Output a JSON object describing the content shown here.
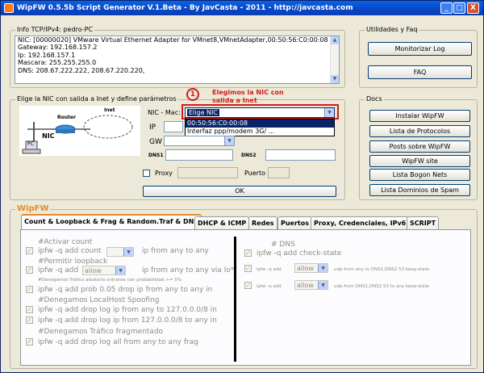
{
  "window": {
    "title": "WipFW 0.5.5b Script Generator V.1.Beta - By JavCasta - 2011 - http://javcasta.com",
    "minimize": "_",
    "maximize": "□",
    "close": "X"
  },
  "info": {
    "caption": "Info TCP/IPv4: pedro-PC",
    "lines": [
      "NIC: [00000020] VMware Virtual Ethernet Adapter for VMnet8,VMnetAdapter,00:50:56:C0:00:08",
      "Gateway: 192.168.157.2",
      "Ip: 192.168.157.1",
      "Mascara: 255.255.255.0",
      "DNS: 208.67.222.222, 208.67.220.220,"
    ]
  },
  "utilidades": {
    "caption": "Utilidades y Faq",
    "monitorizar": "Monitorizar Log",
    "faq": "FAQ"
  },
  "nic": {
    "caption": "Elige la NIC con salida a Inet y define parámetros",
    "diagram": {
      "inet": "Inet",
      "router": "Router",
      "nic": "NIC",
      "pc": "PC"
    },
    "nic_mac_label": "NIC - Mac:",
    "nic_selected": "Elige NIC",
    "nic_options": [
      "00:50:56:C0:00:08",
      "Interfaz ppp/modem 3G/ ..."
    ],
    "ip_label": "IP",
    "gw_label": "GW",
    "dns1_label": "DNS1",
    "dns2_label": "DNS2",
    "proxy_label": "Proxy",
    "puerto_label": "Puerto",
    "ok": "OK",
    "annotation_number": "1",
    "annotation_text": "Elegimos la NIC con salida a Inet"
  },
  "docs": {
    "caption": "Docs",
    "buttons": [
      "Instalar WipFW",
      "Lista de Protocolos",
      "Posts sobre WipFW",
      "WipFW site",
      "Lista Bogon Nets",
      "Lista Dominios de Spam"
    ]
  },
  "wipfw": {
    "caption": "WipFW",
    "tabs": [
      "Count & Loopback & Frag & Random.Traf & DNS",
      "DHCP & ICMP",
      "Redes",
      "Puertos",
      "Proxy, Credenciales, IPv6",
      "SCRIPT"
    ],
    "left": {
      "activar_count": "#Activar count",
      "count_pre": "ipfw -q add  count",
      "count_post": "ip from any to any",
      "permitir_loopback": "#Permitir loopback",
      "loop_pre": "ipfw -q add",
      "loop_value": "allow",
      "loop_post": "ip from any to any via lo*",
      "denegamos_aleatorio": "#Denegamos Tráfico aleatorio entrante con probabilidad >= 5%",
      "prob_rule": "ipfw -q add prob 0.05 drop ip from any to any in",
      "denegamos_localhost": "#Denegamos LocalHost Spoofing",
      "spoof1": "ipfw -q add drop log ip from any to 127.0.0.0/8 in",
      "spoof2": "ipfw -q add drop log ip from 127.0.0.0/8 to any in",
      "denegamos_frag": "#Denegamos Tráfico fragmentado",
      "frag_rule": "ipfw -q add drop log all from any to any frag"
    },
    "right": {
      "dns_header": "# DNS",
      "check_state": "ipfw -q add check-state",
      "r1_pre": "ipfw -q add",
      "r1_value": "allow",
      "r1_post": "udp from any to DNS1,DNS2 53 keep-state",
      "r2_pre": "ipfw -q add",
      "r2_value": "allow",
      "r2_post": "udp from DNS1,DNS2 53 to any keep-state"
    }
  },
  "colors": {
    "accent": "#e68b2c",
    "annotation": "#d41a1a",
    "titlebar": "#0846c8",
    "selection": "#0a246a"
  }
}
